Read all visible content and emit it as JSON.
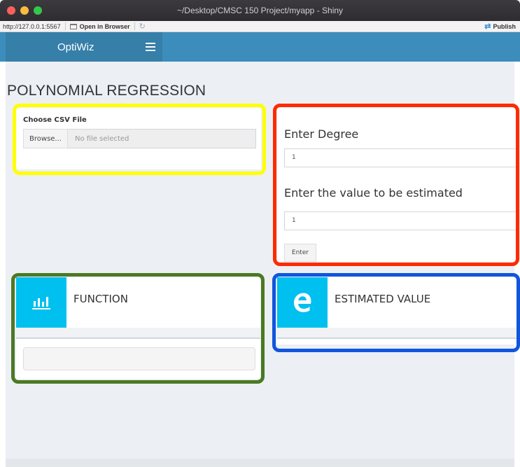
{
  "window": {
    "title": "~/Desktop/CMSC 150 Project/myapp - Shiny",
    "traffic_lights": {
      "close": "#fc605c",
      "minimize": "#fdbc40",
      "maximize": "#34c84a"
    }
  },
  "viewer_toolbar": {
    "url": "http://127.0.0.1:5567",
    "open_in_browser": "Open in Browser",
    "publish": "Publish"
  },
  "header": {
    "brand": "OptiWiz",
    "color": "#3c8dbc"
  },
  "page": {
    "title": "POLYNOMIAL REGRESSION"
  },
  "csv_box": {
    "label": "Choose CSV File",
    "browse_label": "Browse...",
    "file_placeholder": "No file selected",
    "outline_color": "#ffff00"
  },
  "input_box": {
    "degree_label": "Enter Degree",
    "degree_value": "1",
    "estimate_label": "Enter the value to be estimated",
    "estimate_value": "1",
    "enter_label": "Enter",
    "outline_color": "#ff2a00"
  },
  "function_box": {
    "title": "FUNCTION",
    "icon": "bar-chart-icon",
    "outline_color": "#4a7a23"
  },
  "estimated_box": {
    "title": "ESTIMATED VALUE",
    "icon": "edge-browser-icon",
    "outline_color": "#1155dd"
  }
}
